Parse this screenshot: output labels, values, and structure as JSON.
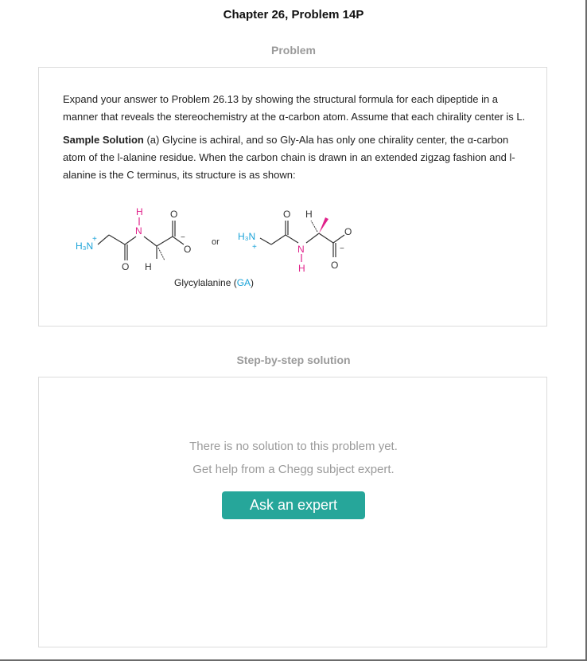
{
  "header": {
    "chapter_title": "Chapter 26, Problem 14P"
  },
  "problem": {
    "heading": "Problem",
    "paragraph": "Expand your answer to Problem 26.13 by showing the structural formula for each dipeptide in a manner that reveals the stereochemistry at the α-carbon atom. Assume that each chirality center is L.",
    "sample_label": "Sample Solution",
    "sample_text": " (a) Glycine is achiral, and so Gly-Ala has only one chirality center, the α-carbon atom of the l-alanine residue. When the carbon chain is drawn in an extended zigzag fashion and l-alanine is the C terminus, its structure is as shown:",
    "structure": {
      "or_label": "or",
      "caption_name": "Glycylalanine (",
      "caption_abbr": "GA",
      "caption_close": ")",
      "atoms": {
        "amine": "H₃N",
        "plus": "+",
        "nitrogen": "N",
        "hydrogen": "H",
        "oxygen": "O",
        "minus": "−"
      },
      "colors": {
        "nitrogen": "#e0218a",
        "amine": "#1aa3d9",
        "carbon": "#333333"
      }
    }
  },
  "solution": {
    "heading": "Step-by-step solution",
    "no_solution_line1": "There is no solution to this problem yet.",
    "no_solution_line2": "Get help from a Chegg subject expert.",
    "button_label": "Ask an expert"
  }
}
